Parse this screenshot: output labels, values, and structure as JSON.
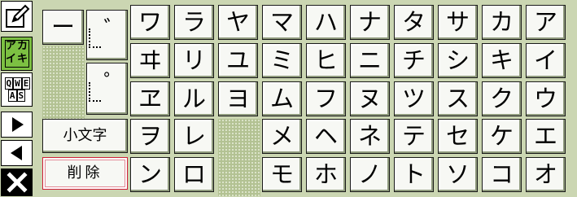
{
  "sidebar": {
    "edit_icon": "pencil-icon",
    "mode_katakana_glyphs": [
      "ア",
      "カ",
      "イ",
      "キ"
    ],
    "mode_qwerty_glyphs": [
      "Q",
      "W",
      "E",
      "A",
      "S"
    ],
    "next_icon": "arrow-right-icon",
    "prev_icon": "arrow-left-icon",
    "close_icon": "close-icon"
  },
  "special_keys": {
    "long_vowel": "ー",
    "dakuten": "゛",
    "handakuten": "゜",
    "small_kana": "小文字",
    "delete": "削除"
  },
  "kana_rows": [
    [
      "ワ",
      "ラ",
      "ヤ",
      "マ",
      "ハ",
      "ナ",
      "タ",
      "サ",
      "カ",
      "ア"
    ],
    [
      "ヰ",
      "リ",
      "ユ",
      "ミ",
      "ヒ",
      "ニ",
      "チ",
      "シ",
      "キ",
      "イ"
    ],
    [
      "ヱ",
      "ル",
      "ヨ",
      "ム",
      "フ",
      "ヌ",
      "ツ",
      "ス",
      "ク",
      "ウ"
    ],
    [
      "ヲ",
      "レ",
      "",
      "メ",
      "ヘ",
      "ネ",
      "テ",
      "セ",
      "ケ",
      "エ"
    ],
    [
      "ン",
      "ロ",
      "",
      "モ",
      "ホ",
      "ノ",
      "ト",
      "ソ",
      "コ",
      "オ"
    ]
  ],
  "colors": {
    "background": "#cbd6b2",
    "accent_green": "#7cc042",
    "delete_border": "#d0203a"
  }
}
